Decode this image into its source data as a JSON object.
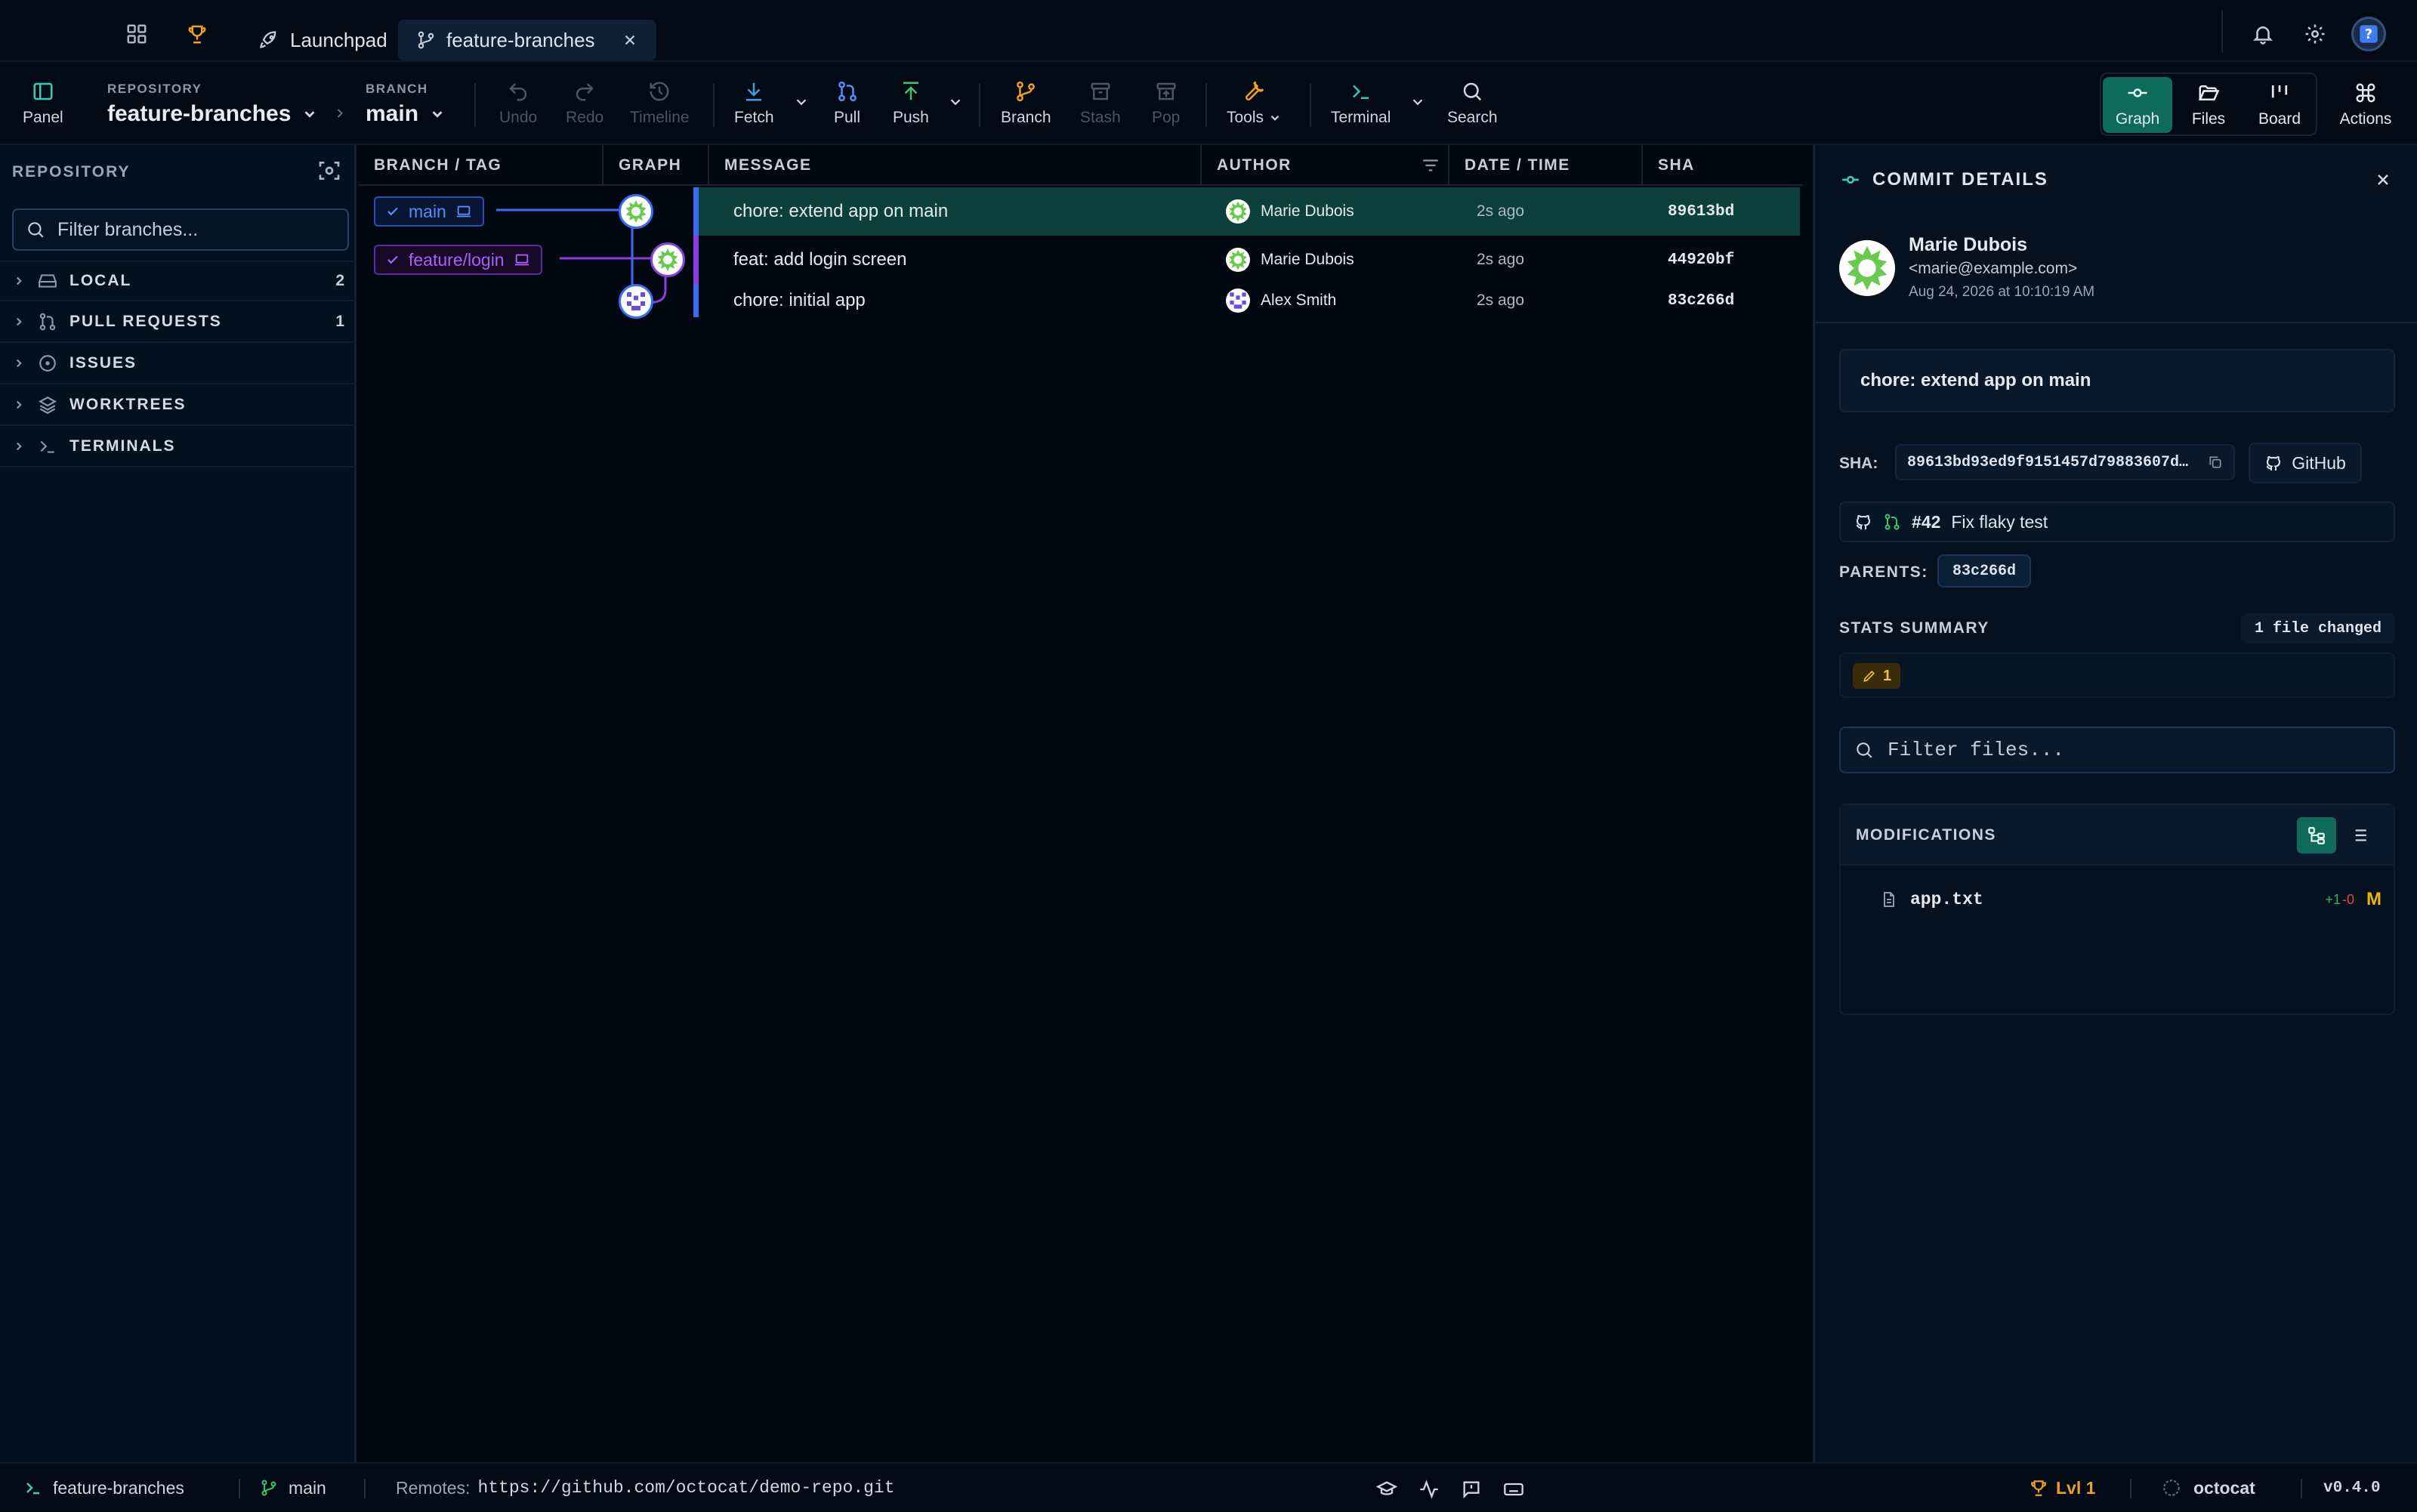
{
  "titlebar": {
    "tabs": [
      {
        "label": "Launchpad"
      },
      {
        "label": "feature-branches"
      }
    ]
  },
  "toolbar": {
    "panel_label": "Panel",
    "repository_caption": "REPOSITORY",
    "repository_name": "feature-branches",
    "branch_caption": "BRANCH",
    "branch_name": "main",
    "buttons": {
      "undo": "Undo",
      "redo": "Redo",
      "timeline": "Timeline",
      "fetch": "Fetch",
      "pull": "Pull",
      "push": "Push",
      "branch": "Branch",
      "stash": "Stash",
      "pop": "Pop",
      "tools": "Tools",
      "terminal": "Terminal",
      "search": "Search"
    },
    "views": {
      "graph": "Graph",
      "files": "Files",
      "board": "Board",
      "actions": "Actions"
    }
  },
  "sidebar": {
    "title": "REPOSITORY",
    "filter_placeholder": "Filter branches...",
    "sections": [
      {
        "label": "LOCAL",
        "count": "2"
      },
      {
        "label": "PULL REQUESTS",
        "count": "1"
      },
      {
        "label": "ISSUES",
        "count": ""
      },
      {
        "label": "WORKTREES",
        "count": ""
      },
      {
        "label": "TERMINALS",
        "count": ""
      }
    ]
  },
  "table": {
    "headers": {
      "branch": "BRANCH / TAG",
      "graph": "GRAPH",
      "message": "MESSAGE",
      "author": "AUTHOR",
      "date": "DATE / TIME",
      "sha": "SHA"
    },
    "rows": [
      {
        "branch": "main",
        "message": "chore: extend app on main",
        "author": "Marie Dubois",
        "date": "2s ago",
        "sha": "89613bd"
      },
      {
        "branch": "feature/login",
        "message": "feat: add login screen",
        "author": "Marie Dubois",
        "date": "2s ago",
        "sha": "44920bf"
      },
      {
        "branch": "",
        "message": "chore: initial app",
        "author": "Alex Smith",
        "date": "2s ago",
        "sha": "83c266d"
      }
    ]
  },
  "details": {
    "title": "COMMIT DETAILS",
    "author_name": "Marie Dubois",
    "author_email": "<marie@example.com>",
    "author_date": "Aug 24, 2026 at 10:10:19 AM",
    "message": "chore: extend app on main",
    "sha_label": "SHA:",
    "sha_value": "89613bd93ed9f9151457d79883607d…",
    "github_label": "GitHub",
    "pr_number": "#42",
    "pr_title": "Fix flaky test",
    "parents_label": "PARENTS:",
    "parent_sha": "83c266d",
    "stats_label": "STATS SUMMARY",
    "files_changed": "1 file changed",
    "modified_count": "1",
    "filter_files_placeholder": "Filter files...",
    "modifications_label": "MODIFICATIONS",
    "files": [
      {
        "name": "app.txt",
        "added": "+1",
        "removed": "-0",
        "status": "M"
      }
    ]
  },
  "statusbar": {
    "repo": "feature-branches",
    "branch": "main",
    "remotes_label": "Remotes:",
    "remotes_url": "https://github.com/octocat/demo-repo.git",
    "level": "Lvl 1",
    "user": "octocat",
    "version": "v0.4.0"
  },
  "colors": {
    "accent_teal": "#0f5c4f",
    "branch_main": "#3b6cf0",
    "branch_feature": "#8b3ee0",
    "selected_row": "#0c3d3a",
    "added": "#2fb36a",
    "removed": "#e04848",
    "modified": "#f0b400"
  }
}
